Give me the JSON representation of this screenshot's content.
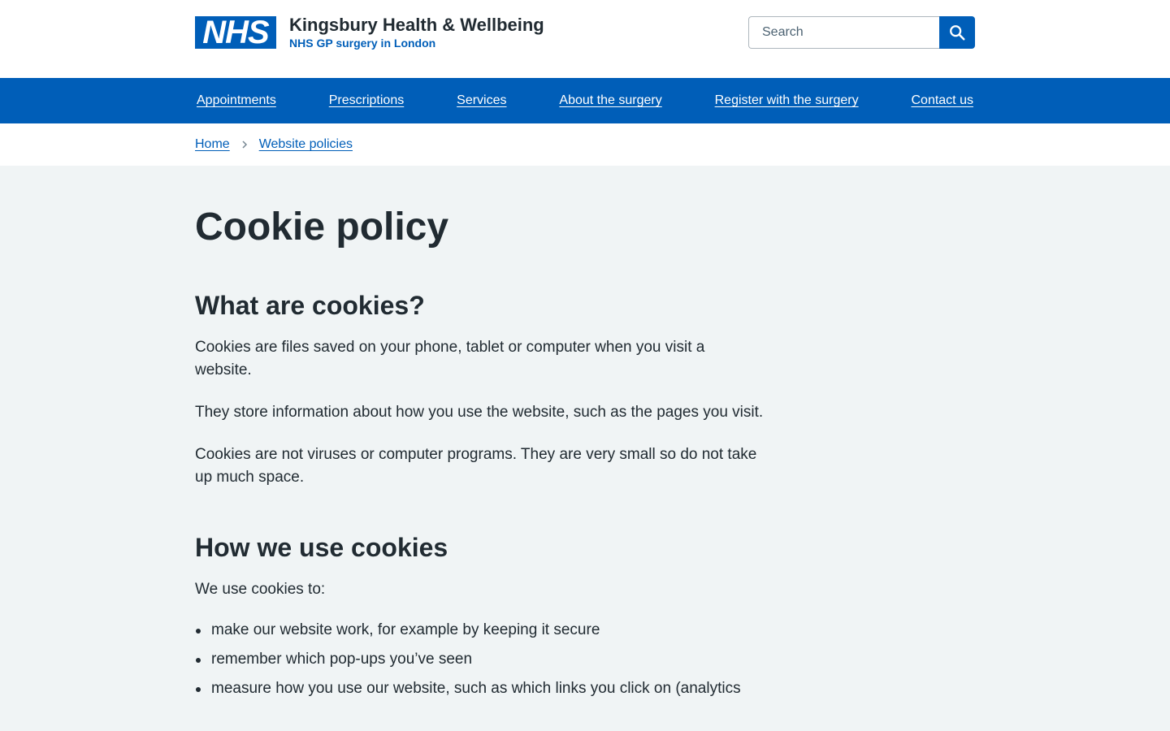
{
  "header": {
    "logo_text": "NHS",
    "org_title": "Kingsbury Health & Wellbeing",
    "org_subtitle": "NHS GP surgery in London",
    "search": {
      "placeholder": "Search",
      "button_icon": "search-icon"
    }
  },
  "colors": {
    "nhs_blue": "#005eb8",
    "page_background": "#f0f4f5",
    "text": "#212b32"
  },
  "nav": {
    "items": [
      {
        "label": "Appointments"
      },
      {
        "label": "Prescriptions"
      },
      {
        "label": "Services"
      },
      {
        "label": "About the surgery"
      },
      {
        "label": "Register with the surgery"
      },
      {
        "label": "Contact us"
      }
    ]
  },
  "breadcrumb": {
    "items": [
      {
        "label": "Home"
      },
      {
        "label": "Website policies"
      }
    ],
    "separator_icon": "chevron-right-icon"
  },
  "main": {
    "title": "Cookie policy",
    "sections": [
      {
        "heading": "What are cookies?",
        "paragraphs": [
          "Cookies are files saved on your phone, tablet or computer when you visit a website.",
          "They store information about how you use the website, such as the pages you visit.",
          "Cookies are not viruses or computer programs. They are very small so do not take up much space."
        ]
      },
      {
        "heading": "How we use cookies",
        "paragraphs": [
          "We use cookies to:"
        ],
        "bullets": [
          "make our website work, for example by keeping it secure",
          "remember which pop-ups you’ve seen",
          "measure how you use our website, such as which links you click on (analytics"
        ]
      }
    ]
  }
}
